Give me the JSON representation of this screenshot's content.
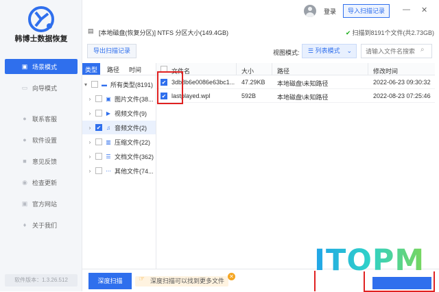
{
  "app": {
    "name": "韩博士数据恢复",
    "version": "软件版本：1.3.26.512"
  },
  "nav": [
    {
      "label": "场景模式",
      "icon": "scene-icon",
      "active": true
    },
    {
      "label": "向导模式",
      "icon": "wizard-icon"
    },
    {
      "label": "联系客服",
      "icon": "service-icon"
    },
    {
      "label": "软件设置",
      "icon": "settings-icon"
    },
    {
      "label": "意见反馈",
      "icon": "feedback-icon"
    },
    {
      "label": "检查更新",
      "icon": "update-icon"
    },
    {
      "label": "官方网站",
      "icon": "website-icon"
    },
    {
      "label": "关于我们",
      "icon": "about-icon"
    }
  ],
  "header": {
    "login": "登录",
    "import_record": "导入扫描记录"
  },
  "path": {
    "disk": "[本地磁盘(恢复分区)] NTFS 分区大小(149.4GB)",
    "scan_result": "扫描到8191个文件(共2.73GB)"
  },
  "toolbar": {
    "export_record": "导出扫描记录",
    "view_mode_label": "视图模式:",
    "view_mode_value": "列表模式",
    "search_placeholder": "请输入文件名搜索"
  },
  "tree": {
    "tabs": [
      "类型",
      "路径",
      "时间"
    ],
    "nodes": [
      {
        "label": "所有类型(8191)",
        "icon": "folder-icon",
        "checked": false,
        "expanded": true
      },
      {
        "label": "图片文件(38...",
        "icon": "image-icon",
        "checked": false
      },
      {
        "label": "视频文件(9)",
        "icon": "video-icon",
        "checked": false
      },
      {
        "label": "音频文件(2)",
        "icon": "audio-icon",
        "checked": true,
        "selected": true
      },
      {
        "label": "压缩文件(22)",
        "icon": "archive-icon",
        "checked": false
      },
      {
        "label": "文档文件(362)",
        "icon": "document-icon",
        "checked": false
      },
      {
        "label": "其他文件(74...",
        "icon": "other-icon",
        "checked": false
      }
    ]
  },
  "table": {
    "columns": [
      "文件名",
      "大小",
      "路径",
      "修改时间"
    ],
    "rows": [
      {
        "name": "3db8b6e0086e63bc1...",
        "size": "47.29KB",
        "path": "本地磁盘\\未知路径",
        "modified": "2022-06-23 09:30:32",
        "checked": true
      },
      {
        "name": "lastplayed.wpl",
        "size": "592B",
        "path": "本地磁盘\\未知路径",
        "modified": "2022-08-23 07:25:46",
        "checked": true
      }
    ]
  },
  "footer": {
    "deep_scan": "深度扫描",
    "tip": "深度扫描可以找到更多文件"
  },
  "watermark": "ITOPM",
  "colors": {
    "accent": "#2f6fed",
    "highlight": "#e02020"
  }
}
